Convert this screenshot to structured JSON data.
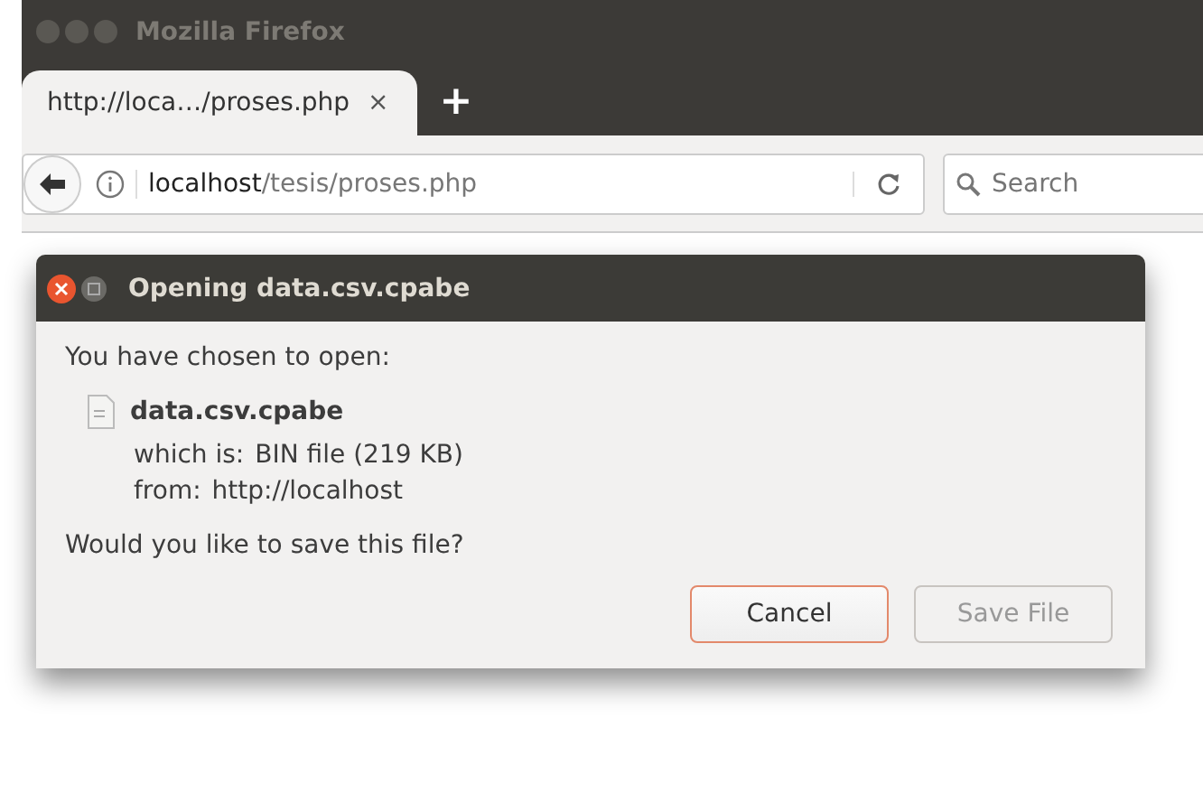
{
  "window": {
    "title": "Mozilla Firefox"
  },
  "tabs": [
    {
      "label": "http://loca…/proses.php",
      "close": "×",
      "selected": true
    }
  ],
  "new_tab": "+",
  "address_bar": {
    "host": "localhost",
    "path": "/tesis/proses.php"
  },
  "search": {
    "placeholder": "Search"
  },
  "dialog": {
    "title": "Opening data.csv.cpabe",
    "intro": "You have chosen to open:",
    "file_name": "data.csv.cpabe",
    "details": [
      {
        "label": "which is:",
        "value": "BIN file (219 KB)"
      },
      {
        "label": "from:",
        "value": "http://localhost"
      }
    ],
    "question": "Would you like to save this file?",
    "buttons": [
      {
        "label": "Cancel",
        "focused": true,
        "disabled": false
      },
      {
        "label": "Save File",
        "focused": false,
        "disabled": true
      }
    ]
  }
}
